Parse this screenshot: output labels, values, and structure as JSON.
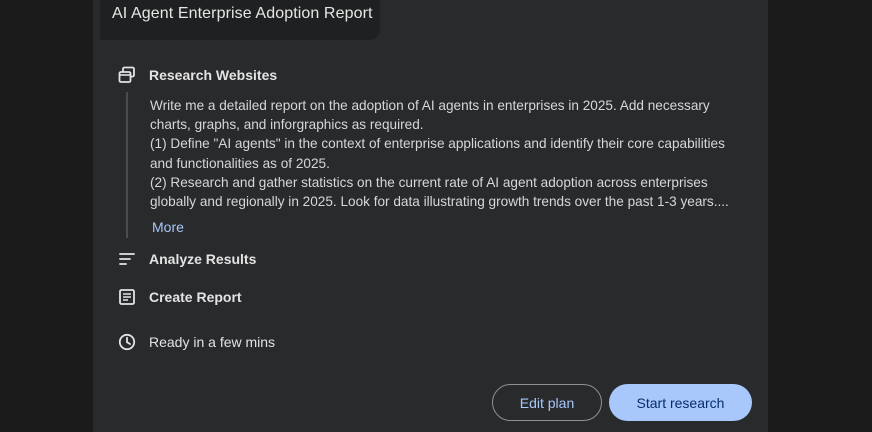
{
  "report": {
    "title": "AI Agent Enterprise Adoption Report"
  },
  "steps": {
    "research": {
      "icon": "research-websites-icon",
      "label": "Research Websites"
    },
    "analyze": {
      "icon": "analyze-results-icon",
      "label": "Analyze Results"
    },
    "create": {
      "icon": "create-report-icon",
      "label": "Create Report"
    },
    "ready": {
      "icon": "clock-icon",
      "label": "Ready in a few mins"
    }
  },
  "plan": {
    "lines": [
      "Write me a detailed report on the adoption of AI agents in enterprises in 2025. Add necessary",
      "charts, graphs, and inforgraphics as required.",
      "(1) Define \"AI agents\" in the context of enterprise applications and identify their core capabilities",
      "and functionalities as of 2025.",
      "(2) Research and gather statistics on the current rate of AI agent adoption across enterprises",
      "globally and regionally in 2025. Look for data illustrating growth trends over the past 1-3 years...."
    ],
    "more_label": "More"
  },
  "actions": {
    "edit_label": "Edit plan",
    "start_label": "Start research"
  },
  "colors": {
    "background": "#1b1b1b",
    "card": "#282a2c",
    "accent": "#a8c7fa",
    "primary_button_text": "#062e6f"
  }
}
